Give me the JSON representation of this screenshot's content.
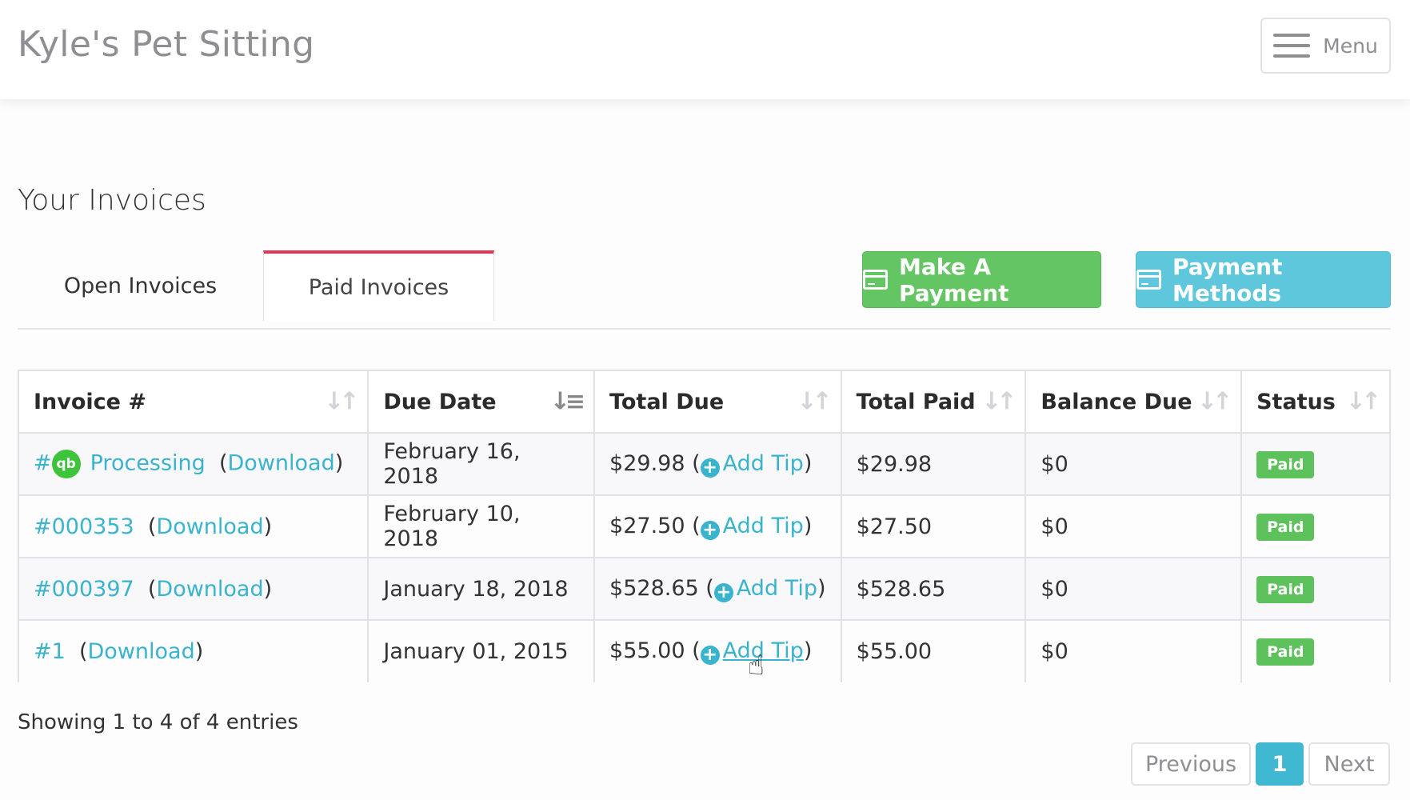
{
  "header": {
    "brand": "Kyle's Pet Sitting",
    "menu_label": "Menu",
    "menu_icon": "hamburger-icon"
  },
  "page": {
    "title": "Your Invoices"
  },
  "tabs": [
    {
      "label": "Open Invoices",
      "active": false
    },
    {
      "label": "Paid Invoices",
      "active": true
    }
  ],
  "actions": {
    "make_payment": "Make A Payment",
    "payment_methods": "Payment Methods",
    "icon": "credit-card-icon",
    "colors": {
      "green": "#64c662",
      "blue": "#5ec7dc",
      "active_tab": "#e23a55",
      "link": "#3ab4ce"
    }
  },
  "table": {
    "columns": [
      "Invoice #",
      "Due Date",
      "Total Due",
      "Total Paid",
      "Balance Due",
      "Status"
    ],
    "sorted_column": "Due Date",
    "add_tip_label": "Add Tip",
    "download_label": "Download",
    "rows": [
      {
        "invoice": "Processing",
        "invoice_prefix": "#",
        "quickbooks": true,
        "due_date": "February 16, 2018",
        "total_due": "$29.98",
        "total_paid": "$29.98",
        "balance_due": "$0",
        "status": "Paid"
      },
      {
        "invoice": "#000353",
        "invoice_prefix": "",
        "quickbooks": false,
        "due_date": "February 10, 2018",
        "total_due": "$27.50",
        "total_paid": "$27.50",
        "balance_due": "$0",
        "status": "Paid"
      },
      {
        "invoice": "#000397",
        "invoice_prefix": "",
        "quickbooks": false,
        "due_date": "January 18, 2018",
        "total_due": "$528.65",
        "total_paid": "$528.65",
        "balance_due": "$0",
        "status": "Paid"
      },
      {
        "invoice": "#1",
        "invoice_prefix": "",
        "quickbooks": false,
        "due_date": "January 01, 2015",
        "total_due": "$55.00",
        "total_paid": "$55.00",
        "balance_due": "$0",
        "status": "Paid"
      }
    ]
  },
  "footer": {
    "showing": "Showing 1 to 4 of 4 entries",
    "pagination": {
      "previous": "Previous",
      "current": "1",
      "next": "Next"
    }
  }
}
